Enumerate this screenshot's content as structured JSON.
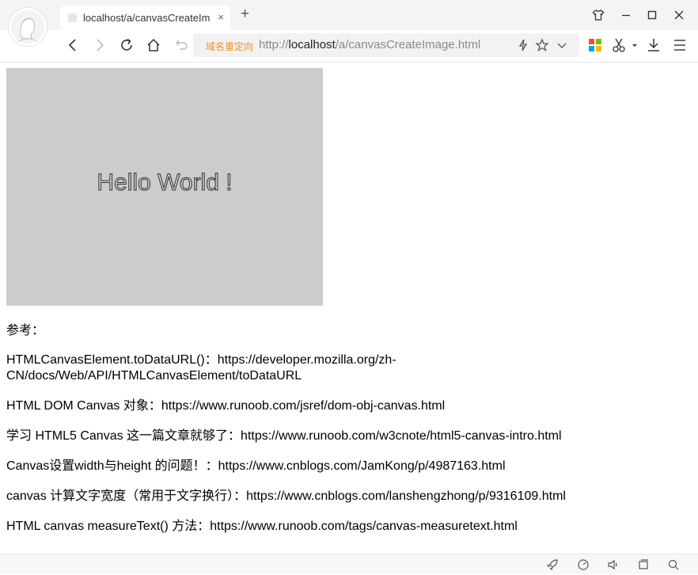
{
  "browser": {
    "tab": {
      "title": "localhost/a/canvasCreateIm",
      "close": "×"
    },
    "new_tab": "+",
    "address": {
      "redirect_label": "域名重定向",
      "url_prefix": "http://",
      "url_host": "localhost",
      "url_path": "/a/canvasCreateImage.html"
    }
  },
  "canvas": {
    "text": "Hello World !",
    "background": "#cccccc",
    "text_color": "#333333"
  },
  "references": {
    "heading": "参考：",
    "items": [
      "HTMLCanvasElement.toDataURL()：https://developer.mozilla.org/zh-CN/docs/Web/API/HTMLCanvasElement/toDataURL",
      "HTML DOM Canvas 对象：https://www.runoob.com/jsref/dom-obj-canvas.html",
      "学习 HTML5 Canvas 这一篇文章就够了：https://www.runoob.com/w3cnote/html5-canvas-intro.html",
      "Canvas设置width与height 的问题！：https://www.cnblogs.com/JamKong/p/4987163.html",
      "canvas 计算文字宽度（常用于文字换行）：https://www.cnblogs.com/lanshengzhong/p/9316109.html",
      "HTML canvas measureText() 方法：https://www.runoob.com/tags/canvas-measuretext.html"
    ]
  }
}
